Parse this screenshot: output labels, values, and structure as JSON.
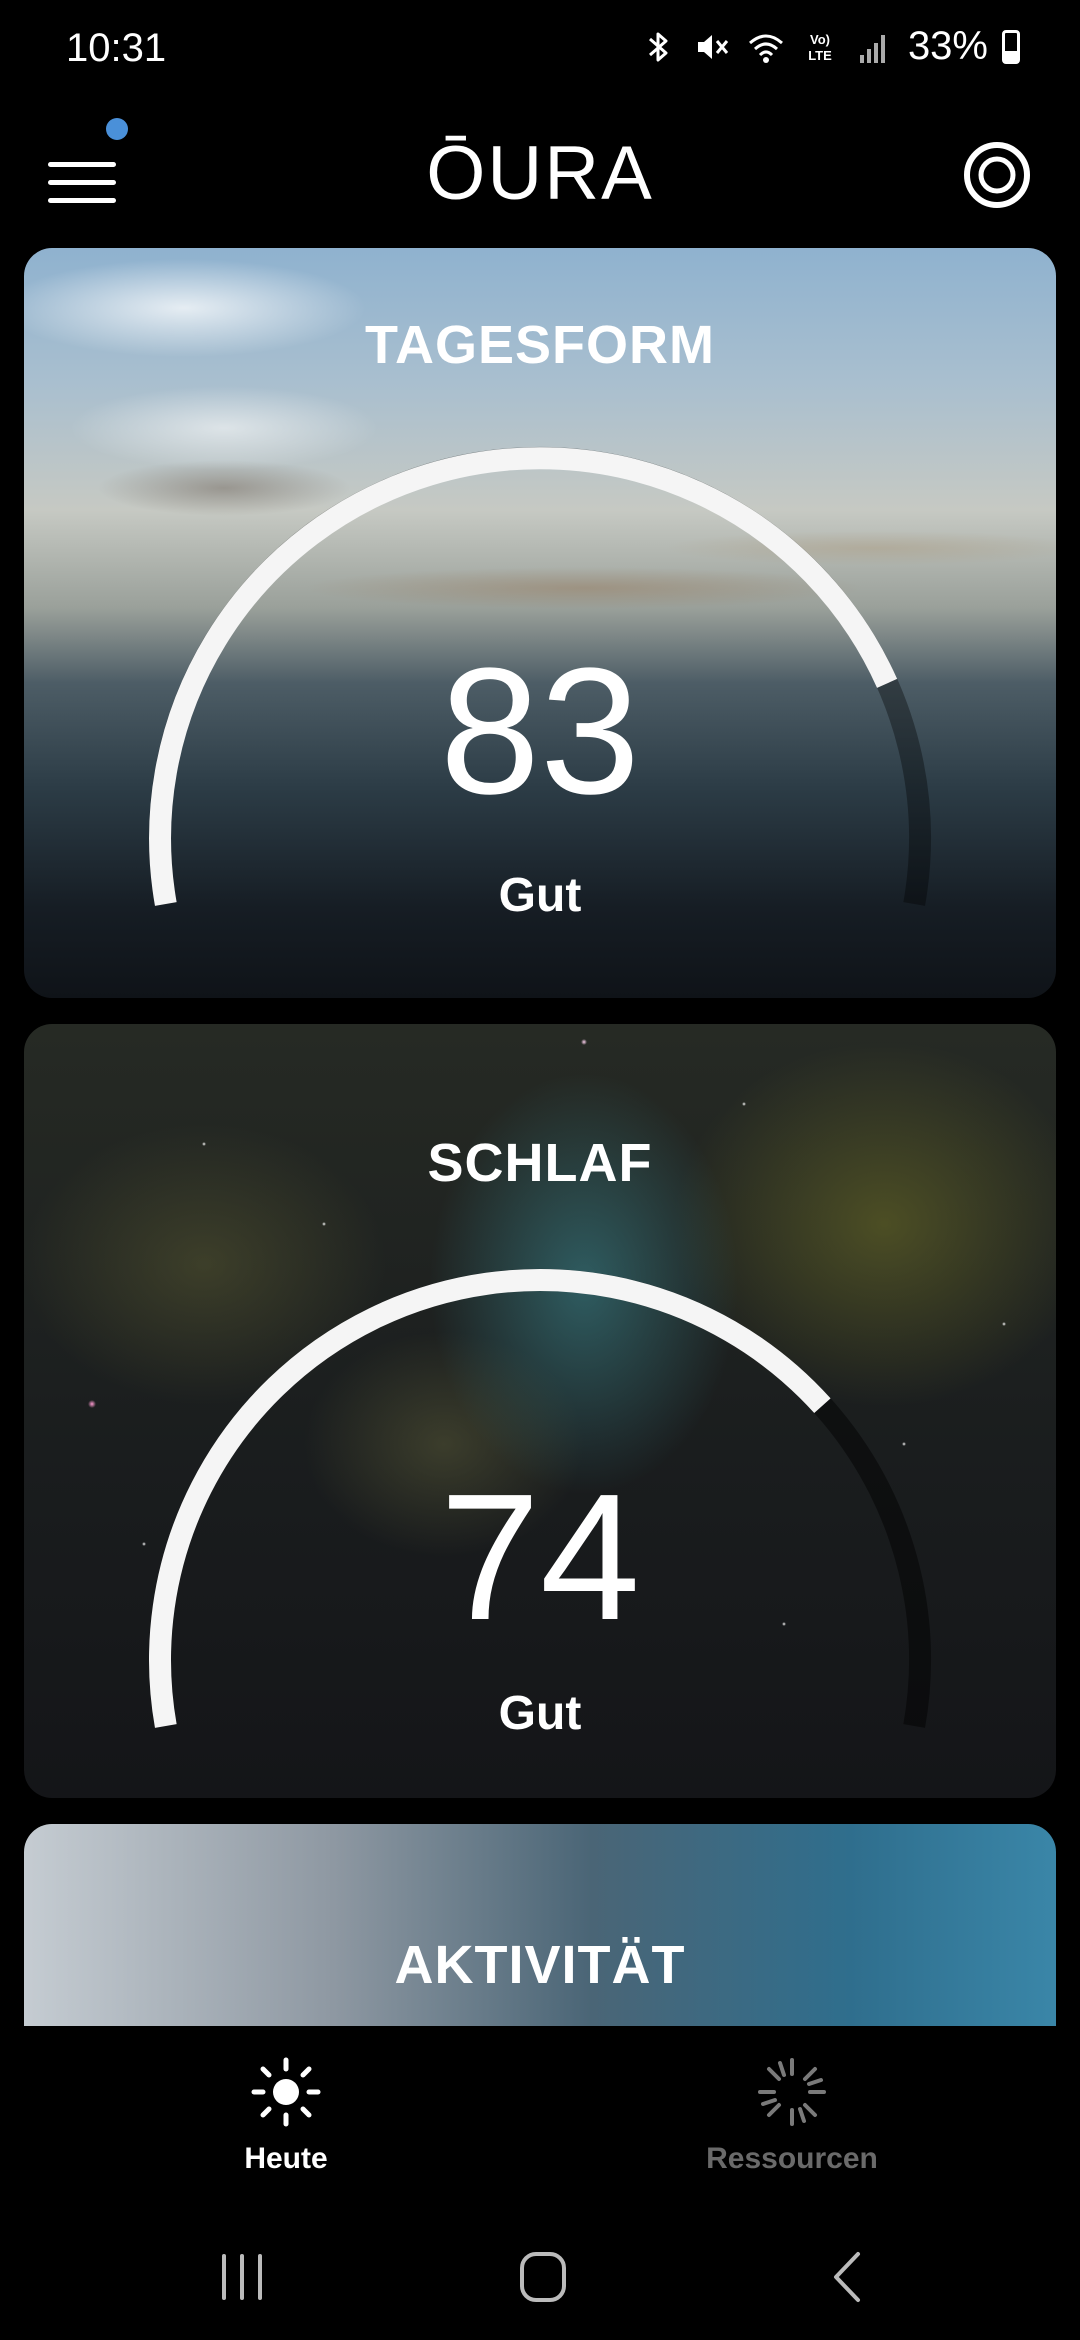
{
  "status_bar": {
    "time": "10:31",
    "battery": "33%",
    "battery_level": 0.33,
    "icons": [
      "bluetooth-icon",
      "mute-icon",
      "wifi-icon",
      "volte-icon",
      "signal-icon",
      "battery-icon"
    ]
  },
  "header": {
    "logo": "ŌURA",
    "menu_icon": "hamburger-menu-icon",
    "ring_icon": "ring-icon",
    "notification_dot_color": "#4a90d9"
  },
  "cards": [
    {
      "title": "TAGESFORM",
      "score": "83",
      "score_value": 83,
      "label": "Gut"
    },
    {
      "title": "SCHLAF",
      "score": "74",
      "score_value": 74,
      "label": "Gut"
    },
    {
      "title": "AKTIVITÄT"
    }
  ],
  "bottom_nav": {
    "items": [
      {
        "label": "Heute",
        "icon": "sun-icon",
        "active": true
      },
      {
        "label": "Ressourcen",
        "icon": "resources-icon",
        "active": false
      }
    ]
  },
  "system_nav": {
    "icons": [
      "recent-apps-icon",
      "home-icon",
      "back-icon"
    ]
  }
}
